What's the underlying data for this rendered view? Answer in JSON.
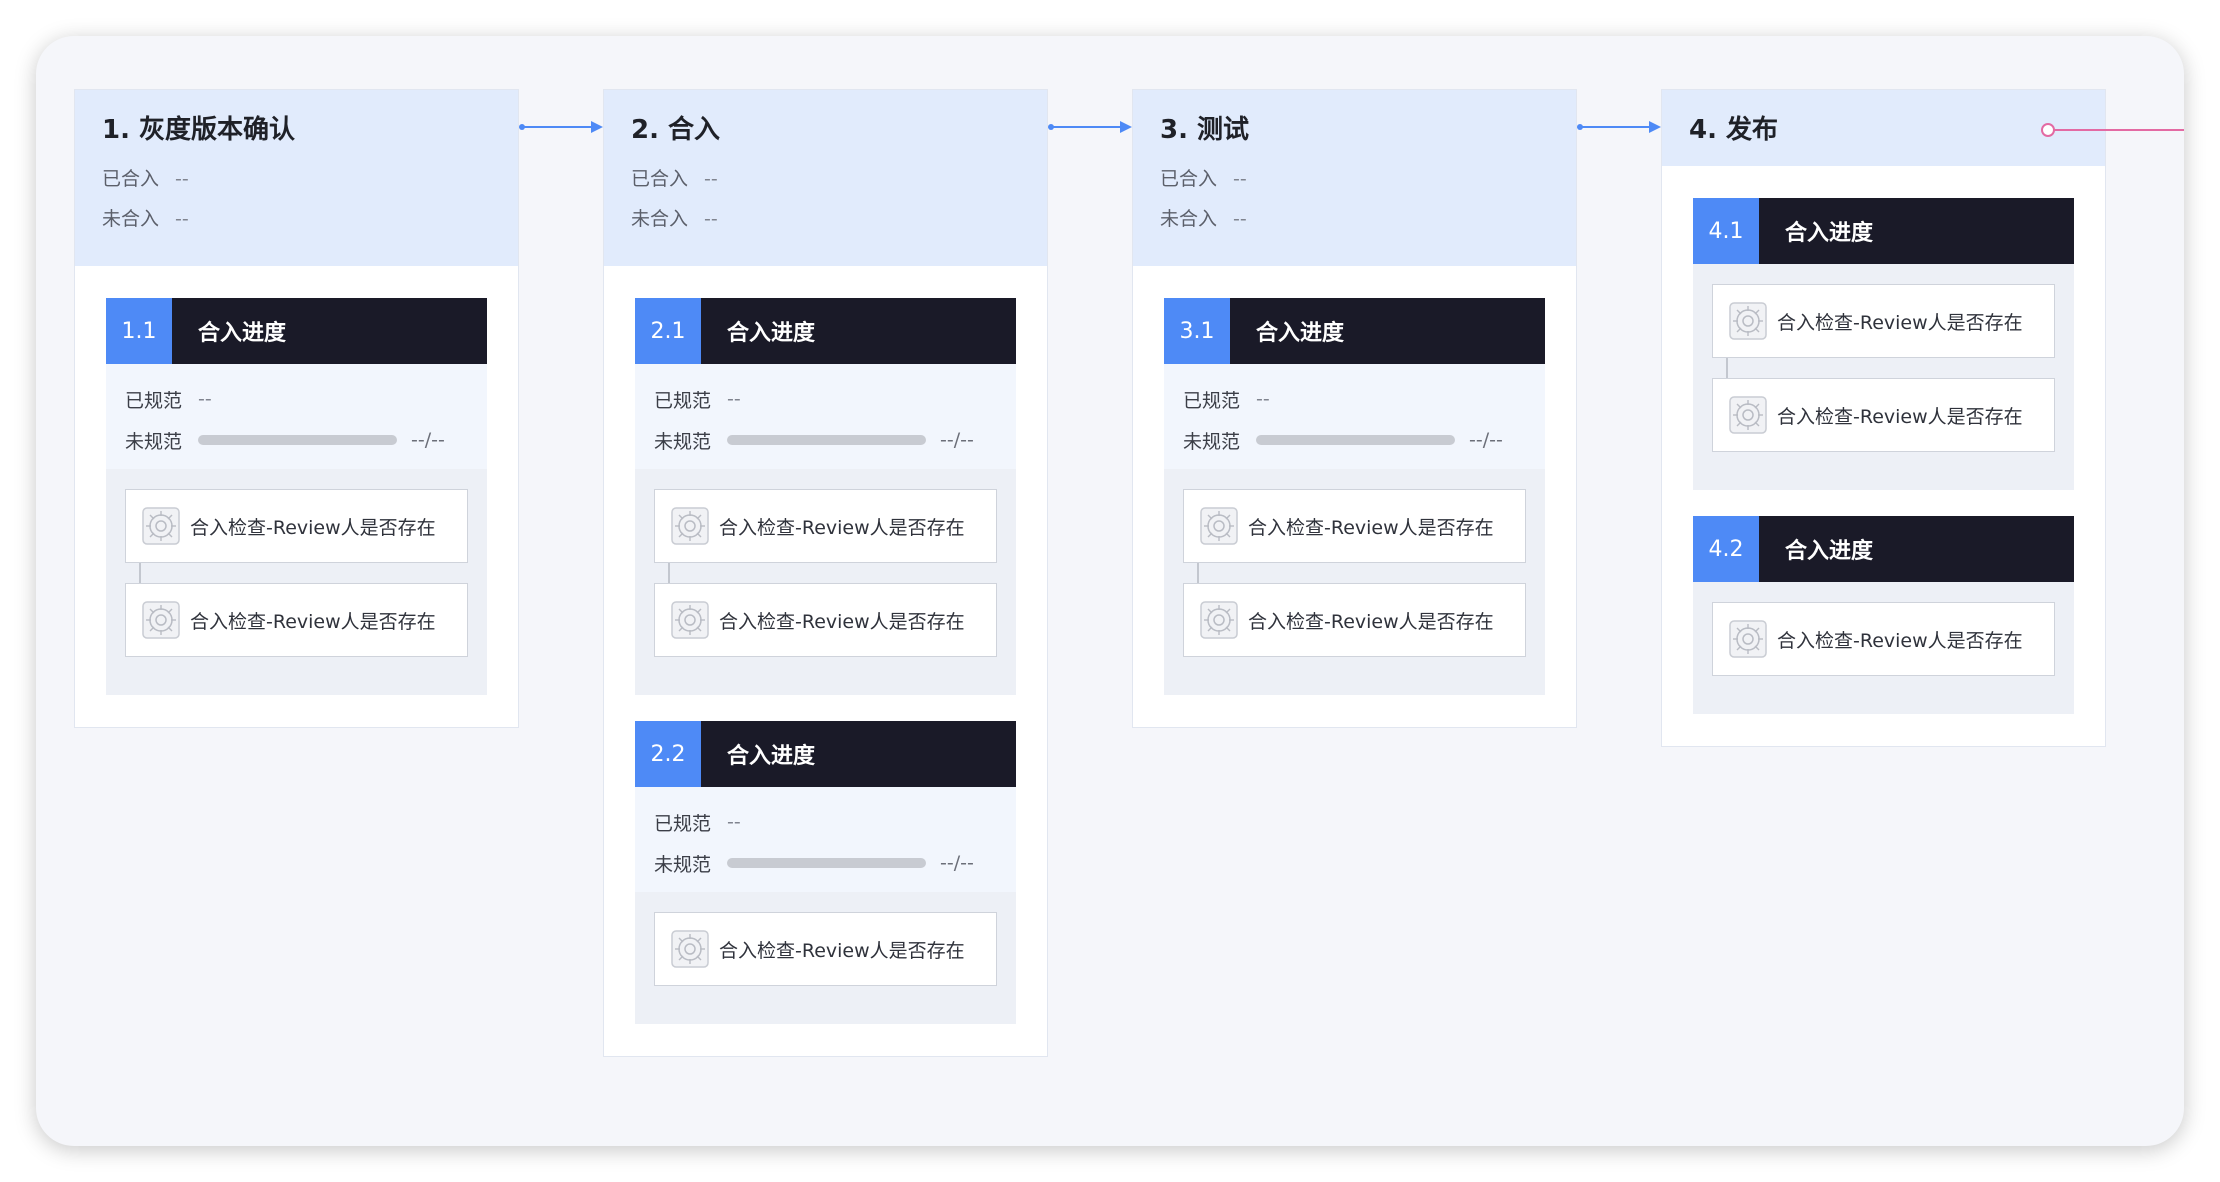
{
  "colors": {
    "accent": "#4e8af6",
    "dark_header": "#1a1a28",
    "stage_head": "#e1ebfc",
    "exit_link": "#e36aa3"
  },
  "stages": [
    {
      "title": "1. 灰度版本确认",
      "merged_label": "已合入",
      "merged_value": "--",
      "unmerged_label": "未合入",
      "unmerged_value": "--",
      "groups": [
        {
          "num": "1.1",
          "title": "合入进度",
          "spec": {
            "ok_label": "已规范",
            "ok_value": "--",
            "bad_label": "未规范",
            "ratio": "--/--",
            "progress": 0
          },
          "checks": [
            {
              "label": "合入检查-Review人是否存在",
              "icon": "gear-icon"
            },
            {
              "label": "合入检查-Review人是否存在",
              "icon": "gear-icon"
            }
          ]
        }
      ]
    },
    {
      "title": "2. 合入",
      "merged_label": "已合入",
      "merged_value": "--",
      "unmerged_label": "未合入",
      "unmerged_value": "--",
      "groups": [
        {
          "num": "2.1",
          "title": "合入进度",
          "spec": {
            "ok_label": "已规范",
            "ok_value": "--",
            "bad_label": "未规范",
            "ratio": "--/--",
            "progress": 0
          },
          "checks": [
            {
              "label": "合入检查-Review人是否存在",
              "icon": "gear-icon"
            },
            {
              "label": "合入检查-Review人是否存在",
              "icon": "gear-icon"
            }
          ]
        },
        {
          "num": "2.2",
          "title": "合入进度",
          "spec": {
            "ok_label": "已规范",
            "ok_value": "--",
            "bad_label": "未规范",
            "ratio": "--/--",
            "progress": 0
          },
          "checks": [
            {
              "label": "合入检查-Review人是否存在",
              "icon": "gear-icon"
            }
          ]
        }
      ]
    },
    {
      "title": "3. 测试",
      "merged_label": "已合入",
      "merged_value": "--",
      "unmerged_label": "未合入",
      "unmerged_value": "--",
      "groups": [
        {
          "num": "3.1",
          "title": "合入进度",
          "spec": {
            "ok_label": "已规范",
            "ok_value": "--",
            "bad_label": "未规范",
            "ratio": "--/--",
            "progress": 0
          },
          "checks": [
            {
              "label": "合入检查-Review人是否存在",
              "icon": "gear-icon"
            },
            {
              "label": "合入检查-Review人是否存在",
              "icon": "gear-icon"
            }
          ]
        }
      ]
    },
    {
      "title": "4. 发布",
      "groups": [
        {
          "num": "4.1",
          "title": "合入进度",
          "checks": [
            {
              "label": "合入检查-Review人是否存在",
              "icon": "gear-icon"
            },
            {
              "label": "合入检查-Review人是否存在",
              "icon": "gear-icon"
            }
          ]
        },
        {
          "num": "4.2",
          "title": "合入进度",
          "checks": [
            {
              "label": "合入检查-Review人是否存在",
              "icon": "gear-icon"
            }
          ]
        }
      ]
    }
  ]
}
